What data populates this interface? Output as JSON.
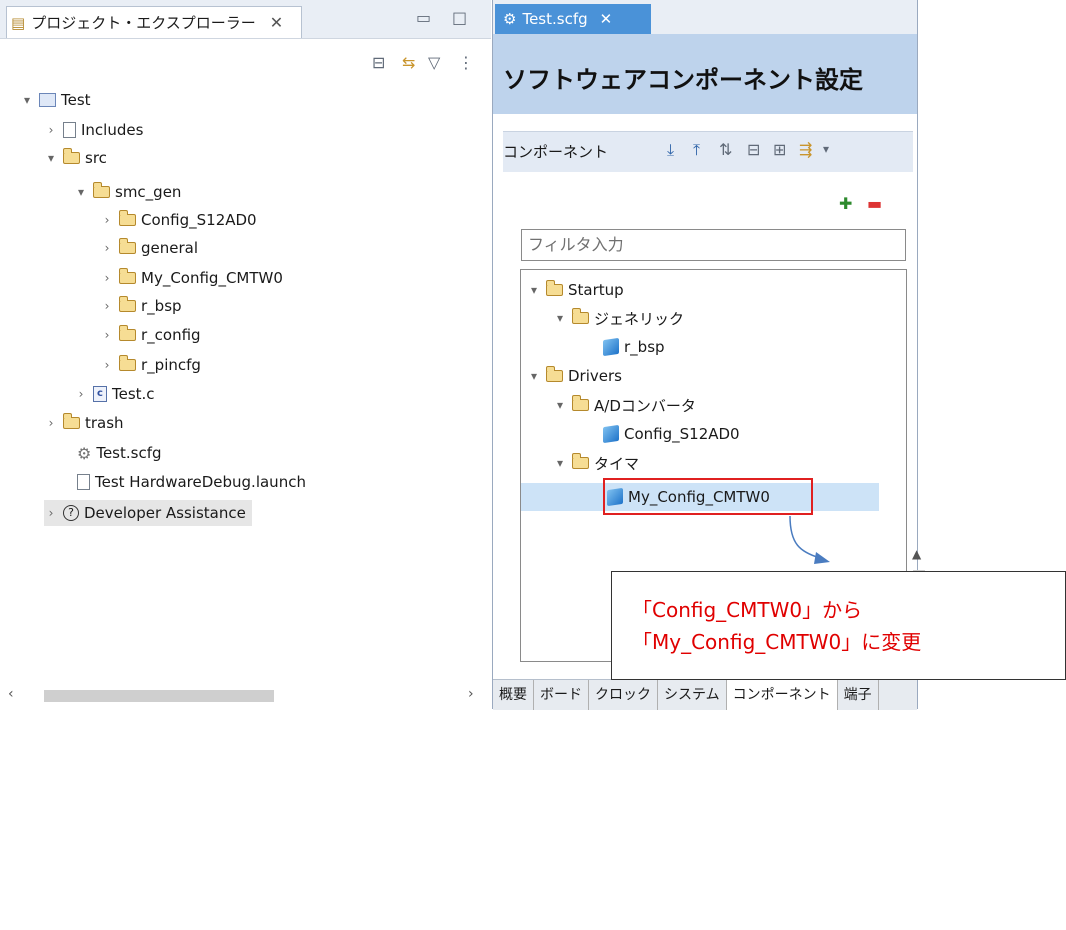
{
  "left_panel": {
    "tab_label": "プロジェクト・エクスプローラー",
    "tab_close": "✕",
    "tree": {
      "project": "Test",
      "includes": "Includes",
      "src": "src",
      "smc_gen": "smc_gen",
      "config_s12ad0": "Config_S12AD0",
      "general": "general",
      "my_config_cmtw0": "My_Config_CMTW0",
      "r_bsp": "r_bsp",
      "r_config": "r_config",
      "r_pincfg": "r_pincfg",
      "test_c": "Test.c",
      "trash": "trash",
      "test_scfg": "Test.scfg",
      "launch": "Test HardwareDebug.launch",
      "dev_assist": "Developer Assistance"
    }
  },
  "editor": {
    "tab_label": "Test.scfg",
    "tab_close": "✕",
    "title": "ソフトウェアコンポーネント設定",
    "components_label": "コンポーネント",
    "filter_placeholder": "フィルタ入力",
    "tree": {
      "startup": "Startup",
      "generic": "ジェネリック",
      "r_bsp": "r_bsp",
      "drivers": "Drivers",
      "adc": "A/Dコンバータ",
      "config_s12ad0": "Config_S12AD0",
      "timer": "タイマ",
      "my_config_cmtw0": "My_Config_CMTW0"
    },
    "bottom_tabs": [
      "概要",
      "ボード",
      "クロック",
      "システム",
      "コンポーネント",
      "端子"
    ]
  },
  "callout": {
    "line1": "「Config_CMTW0」から",
    "line2": "「My_Config_CMTW0」に変更"
  },
  "colors": {
    "accent": "#4a92d8",
    "header_band": "#bed3ec",
    "highlight": "#e02020"
  }
}
